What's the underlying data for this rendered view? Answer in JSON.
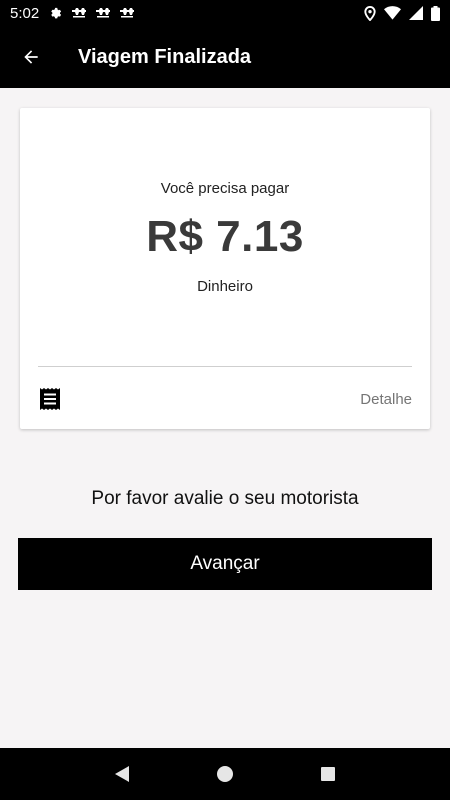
{
  "status_bar": {
    "time": "5:02",
    "left_icons": [
      "gear-icon",
      "notification-icon",
      "notification-icon",
      "notification-icon"
    ],
    "right_icons": [
      "location-pin-icon",
      "wifi-icon",
      "signal-icon",
      "battery-icon"
    ]
  },
  "app_bar": {
    "back_icon": "arrow-left-icon",
    "title": "Viagem Finalizada"
  },
  "payment_card": {
    "label": "Você precisa pagar",
    "amount": "R$ 7.13",
    "method": "Dinheiro",
    "receipt_icon": "receipt-icon",
    "detail_label": "Detalhe"
  },
  "rating": {
    "prompt": "Por favor avalie o seu motorista"
  },
  "actions": {
    "next_label": "Avançar"
  },
  "nav_bar": {
    "icons": [
      "back-triangle-icon",
      "home-circle-icon",
      "recents-square-icon"
    ]
  },
  "colors": {
    "app_bar": "#000000",
    "background": "#f6f4f5",
    "card": "#ffffff",
    "button": "#000000",
    "detail_text": "#757575"
  }
}
